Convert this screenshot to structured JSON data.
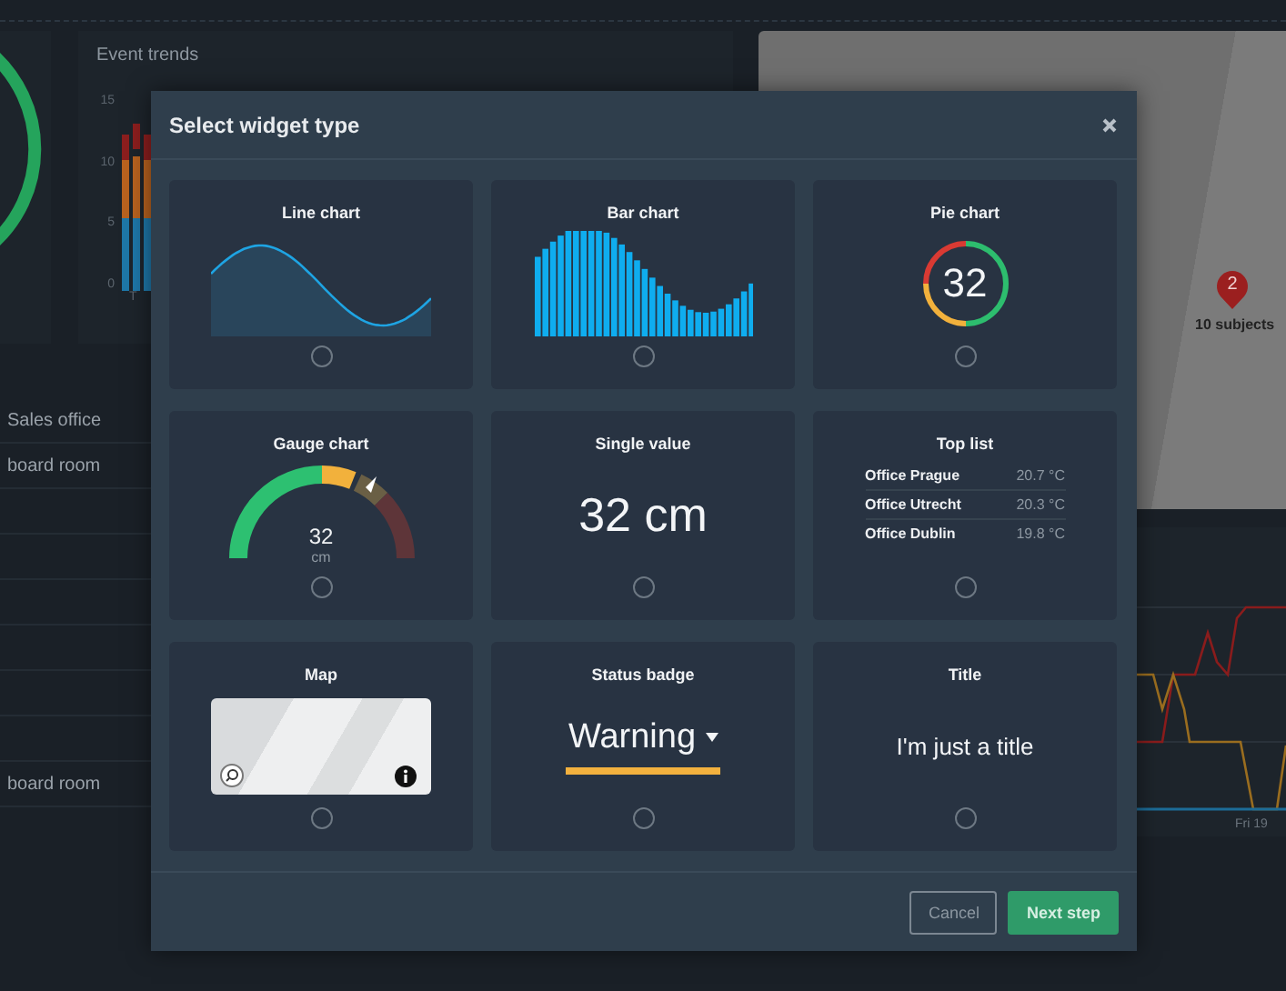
{
  "background": {
    "event_trends": {
      "title": "Event trends",
      "y_ticks": [
        "15",
        "10",
        "5",
        "0"
      ],
      "x_label": "T"
    },
    "table": {
      "rows": [
        {
          "label": "Sales office"
        },
        {
          "label": "board room"
        },
        {},
        {},
        {},
        {},
        {},
        {},
        {
          "label": "board room"
        }
      ]
    },
    "map": {
      "marker": {
        "count": "2",
        "label": "10 subjects"
      }
    },
    "line_chart": {
      "x_label": "Fri 19"
    }
  },
  "dialog": {
    "title": "Select widget type",
    "widgets": [
      {
        "kind": "line",
        "title": "Line chart",
        "selected": false
      },
      {
        "kind": "bar",
        "title": "Bar chart",
        "selected": false
      },
      {
        "kind": "pie",
        "title": "Pie chart",
        "value": "32",
        "selected": false
      },
      {
        "kind": "gauge",
        "title": "Gauge chart",
        "value": "32",
        "unit": "cm",
        "selected": false
      },
      {
        "kind": "single",
        "title": "Single value",
        "value": "32 cm",
        "selected": false
      },
      {
        "kind": "toplist",
        "title": "Top list",
        "items": [
          {
            "name": "Office Prague",
            "value": "20.7 °C"
          },
          {
            "name": "Office Utrecht",
            "value": "20.3 °C"
          },
          {
            "name": "Office Dublin",
            "value": "19.8 °C"
          }
        ],
        "selected": false
      },
      {
        "kind": "map",
        "title": "Map",
        "selected": false
      },
      {
        "kind": "status",
        "title": "Status badge",
        "value": "Warning",
        "selected": false
      },
      {
        "kind": "title",
        "title": "Title",
        "value": "I'm just a title",
        "selected": false
      }
    ],
    "buttons": [
      {
        "kind": "secondary",
        "label": "Cancel"
      },
      {
        "kind": "primary",
        "label": "Next step"
      }
    ]
  }
}
